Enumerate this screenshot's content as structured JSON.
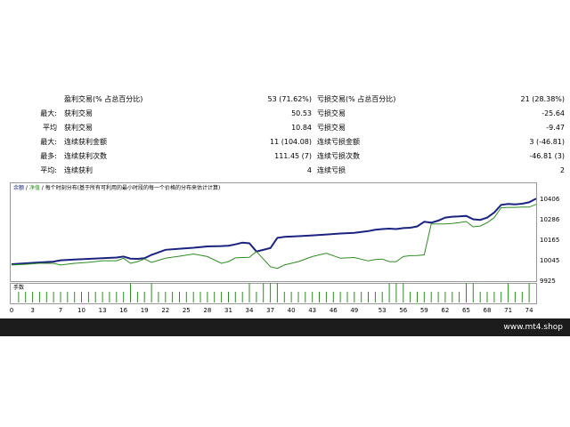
{
  "stats": [
    {
      "l1": "",
      "l2": "盈利交易(% 占总百分比)",
      "v1": "53 (71.62%)",
      "l3": "亏损交易(% 占总百分比)",
      "v2": "21 (28.38%)"
    },
    {
      "l1": "最大:",
      "l2": "获利交易",
      "v1": "50.53",
      "l3": "亏损交易",
      "v2": "-25.64"
    },
    {
      "l1": "平均",
      "l2": "获利交易",
      "v1": "10.84",
      "l3": "亏损交易",
      "v2": "-9.47"
    },
    {
      "l1": "最大:",
      "l2": "连续获利金额",
      "v1": "11 (104.08)",
      "l3": "连续亏损金额",
      "v2": "3 (-46.81)"
    },
    {
      "l1": "最多:",
      "l2": "连续获利次数",
      "v1": "111.45 (7)",
      "l3": "连续亏损次数",
      "v2": "-46.81 (3)"
    },
    {
      "l1": "平均:",
      "l2": "连续获利",
      "v1": "4",
      "l3": "连续亏损",
      "v2": "2"
    }
  ],
  "graph": {
    "legend_balance": "余额",
    "legend_sep1": " / ",
    "legend_equity": "净值",
    "legend_sep2": " / ",
    "legend_desc": "每个时刻分布(基于所有可利用的最小时段的每一个价格的分布来估计计算)",
    "volume_label": "手数"
  },
  "chart_data": {
    "type": "line",
    "ylim": [
      9925,
      10450
    ],
    "y_ticks": [
      "10406",
      "10286",
      "10165",
      "10045",
      "9925"
    ],
    "y_tick_values": [
      10406,
      10286,
      10165,
      10045,
      9925
    ],
    "x_ticks": [
      "0",
      "3",
      "7",
      "10",
      "13",
      "16",
      "19",
      "22",
      "25",
      "28",
      "31",
      "34",
      "37",
      "40",
      "43",
      "46",
      "49",
      "53",
      "56",
      "59",
      "62",
      "65",
      "68",
      "71",
      "74"
    ],
    "xlim": [
      0,
      75
    ],
    "series": [
      {
        "name": "余额",
        "color": "#1a237e",
        "x": [
          0,
          2,
          4,
          6,
          7,
          9,
          11,
          13,
          15,
          16,
          17,
          18,
          19,
          20,
          22,
          24,
          26,
          28,
          30,
          31,
          32,
          33,
          34,
          35,
          37,
          38,
          39,
          41,
          43,
          45,
          47,
          49,
          51,
          52,
          53,
          54,
          55,
          56,
          57,
          58,
          59,
          60,
          61,
          62,
          63,
          64,
          65,
          66,
          67,
          68,
          69,
          70,
          71,
          72,
          73,
          74,
          75
        ],
        "y": [
          10025,
          10030,
          10035,
          10040,
          10048,
          10052,
          10056,
          10060,
          10064,
          10070,
          10058,
          10056,
          10060,
          10080,
          10110,
          10116,
          10122,
          10130,
          10132,
          10134,
          10142,
          10152,
          10148,
          10100,
          10120,
          10180,
          10186,
          10190,
          10195,
          10200,
          10206,
          10210,
          10220,
          10228,
          10232,
          10235,
          10232,
          10238,
          10240,
          10248,
          10275,
          10270,
          10282,
          10300,
          10305,
          10307,
          10310,
          10290,
          10286,
          10300,
          10330,
          10375,
          10380,
          10378,
          10382,
          10390,
          10412
        ]
      },
      {
        "name": "净值",
        "color": "#2e8b22",
        "x": [
          0,
          2,
          4,
          6,
          7,
          9,
          11,
          13,
          15,
          16,
          17,
          18,
          19,
          20,
          22,
          24,
          26,
          28,
          30,
          31,
          32,
          33,
          34,
          35,
          37,
          38,
          39,
          41,
          43,
          45,
          47,
          49,
          51,
          52,
          53,
          54,
          55,
          56,
          57,
          58,
          59,
          60,
          61,
          62,
          63,
          64,
          65,
          66,
          67,
          68,
          69,
          70,
          71,
          72,
          73,
          74,
          75
        ],
        "y": [
          10020,
          10024,
          10030,
          10030,
          10020,
          10030,
          10036,
          10045,
          10045,
          10060,
          10030,
          10040,
          10056,
          10035,
          10060,
          10072,
          10085,
          10070,
          10030,
          10040,
          10062,
          10064,
          10065,
          10100,
          10010,
          10000,
          10020,
          10040,
          10070,
          10090,
          10060,
          10064,
          10044,
          10052,
          10055,
          10040,
          10040,
          10070,
          10075,
          10076,
          10080,
          10262,
          10262,
          10262,
          10265,
          10270,
          10277,
          10245,
          10250,
          10270,
          10300,
          10358,
          10360,
          10360,
          10362,
          10362,
          10378
        ]
      }
    ],
    "volume_bars": {
      "name": "手数",
      "x": [
        1,
        2,
        3,
        4,
        5,
        6,
        7,
        8,
        9,
        10,
        11,
        12,
        13,
        14,
        15,
        16,
        17,
        18,
        19,
        20,
        21,
        22,
        23,
        24,
        25,
        26,
        27,
        28,
        29,
        30,
        31,
        32,
        33,
        34,
        35,
        36,
        37,
        38,
        39,
        40,
        41,
        42,
        43,
        44,
        45,
        46,
        47,
        48,
        49,
        50,
        51,
        52,
        53,
        54,
        55,
        56,
        57,
        58,
        59,
        60,
        61,
        62,
        63,
        64,
        65,
        66,
        67,
        68,
        69,
        70,
        71,
        72,
        73,
        74
      ],
      "values": [
        1,
        1,
        1,
        1,
        1,
        1,
        1,
        1,
        1,
        1,
        1,
        1,
        1,
        1,
        1,
        1,
        1.8,
        1,
        1,
        1.8,
        1,
        1,
        1,
        1,
        1,
        1,
        1,
        1,
        1,
        1,
        1,
        1,
        1,
        1.8,
        1,
        1.8,
        1.8,
        1.8,
        1,
        1,
        1,
        1,
        1,
        1,
        1,
        1,
        1,
        1,
        1,
        1,
        1,
        1,
        1,
        1.8,
        1.8,
        1.8,
        1,
        1,
        1,
        1,
        1,
        1,
        1,
        1,
        1.8,
        1.8,
        1,
        1,
        1,
        1,
        1.8,
        1,
        1,
        1.8
      ]
    }
  },
  "footer": {
    "site": "www.mt4.shop"
  }
}
